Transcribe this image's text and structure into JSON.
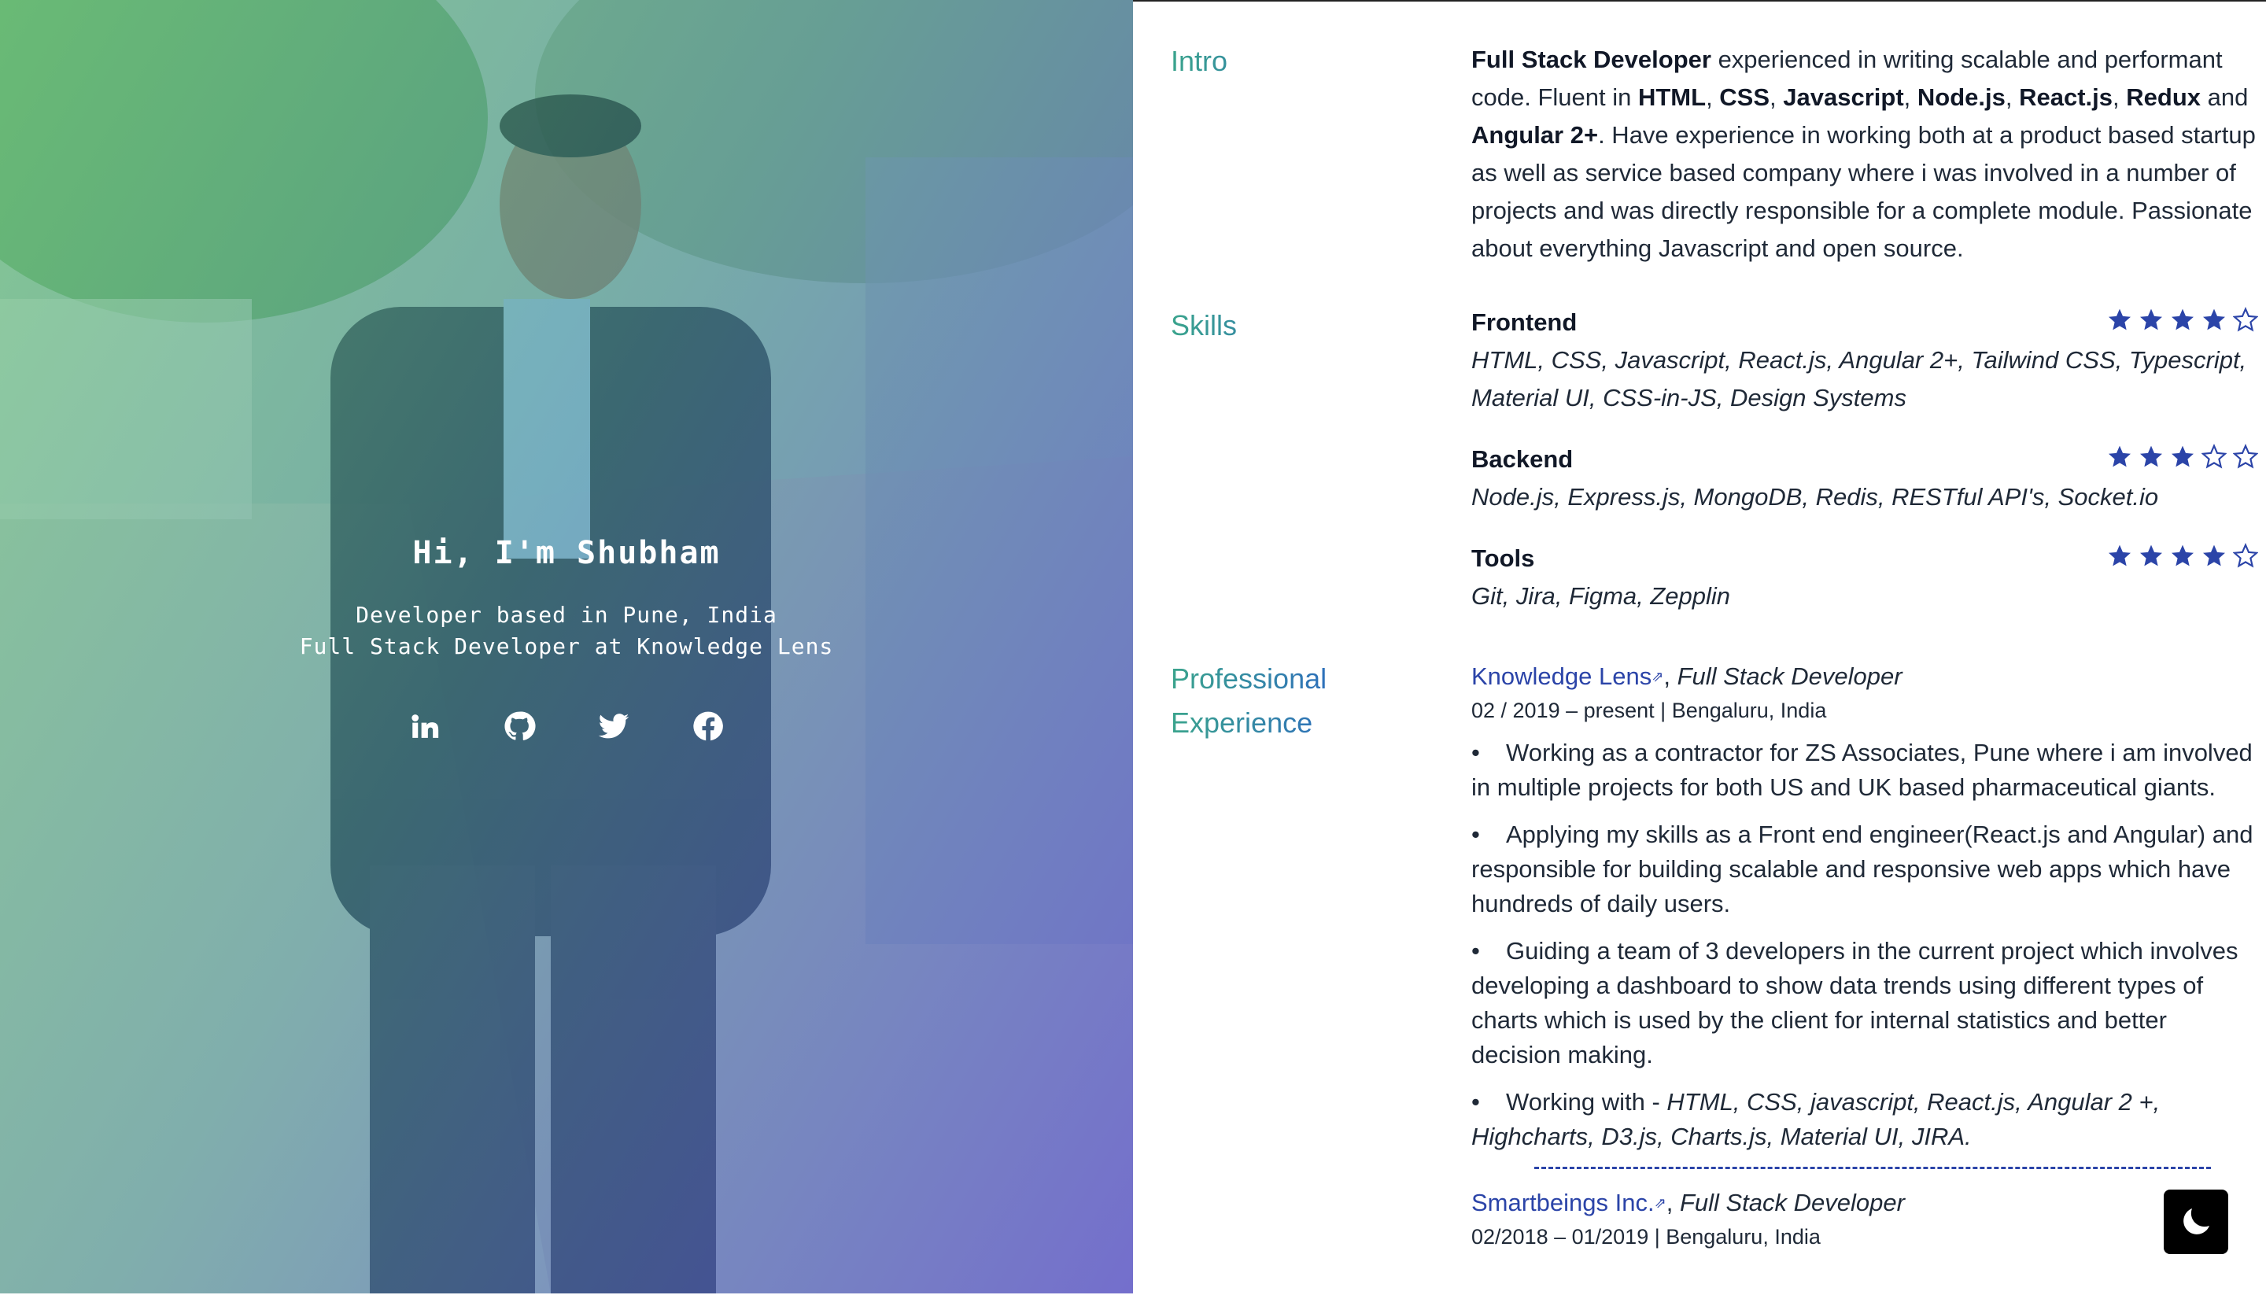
{
  "hero": {
    "greeting": "Hi, I'm Shubham",
    "line1": "Developer based in Pune, India",
    "line2": "Full Stack Developer at Knowledge Lens",
    "socials": [
      "linkedin-icon",
      "github-icon",
      "twitter-icon",
      "facebook-icon"
    ]
  },
  "intro": {
    "label": "Intro",
    "p1": "Full Stack Developer",
    "p2": " experienced in writing scalable and performant code. Fluent in ",
    "t1": "HTML",
    "t2": "CSS",
    "t3": "Javascript",
    "t4": "Node.js",
    "t5": "React.js",
    "t6": "Redux",
    "t7": "Angular 2+",
    "p3": ". Have experience in working both at a product based startup as well as service based company where i was involved in a number of projects and was directly responsible for a complete module. Passionate about everything Javascript and open source."
  },
  "skills": {
    "label": "Skills",
    "items": [
      {
        "name": "Frontend",
        "desc": "HTML, CSS, Javascript, React.js, Angular 2+, Tailwind CSS, Typescript, Material UI, CSS-in-JS, Design Systems",
        "rating": 4,
        "max": 5
      },
      {
        "name": "Backend",
        "desc": "Node.js, Express.js, MongoDB, Redis, RESTful API's, Socket.io",
        "rating": 3,
        "max": 5
      },
      {
        "name": "Tools",
        "desc": "Git, Jira, Figma, Zepplin",
        "rating": 4,
        "max": 5
      }
    ]
  },
  "experience": {
    "label1": "Professional",
    "label2": "Experience",
    "jobs": [
      {
        "company": "Knowledge Lens",
        "role": "Full Stack Developer",
        "meta": "02 / 2019 – present | Bengaluru, India",
        "bullets": [
          "Working as a contractor for ZS Associates, Pune where i am involved in multiple projects for both US and UK based pharmaceutical giants.",
          "Applying my skills as a Front end engineer(React.js and Angular) and responsible for building scalable and responsive web apps which have hundreds of daily users.",
          "Guiding a team of 3 developers in the current project which involves developing a dashboard to show data trends using different types of charts which is used by the client for internal statistics and better decision making."
        ],
        "tools_prefix": "Working with - ",
        "tools": "HTML, CSS, javascript, React.js, Angular 2 +, Highcharts, D3.js, Charts.js, Material UI, JIRA."
      },
      {
        "company": "Smartbeings Inc.",
        "role": "Full Stack Developer",
        "meta": "02/2018 – 01/2019 | Bengaluru, India"
      }
    ]
  },
  "colors": {
    "accent": "#2b44a8",
    "gradient_start": "#3aa48c",
    "gradient_end": "#2c63c7",
    "star": "#2b44a8"
  },
  "theme_toggle_icon": "moon-icon"
}
